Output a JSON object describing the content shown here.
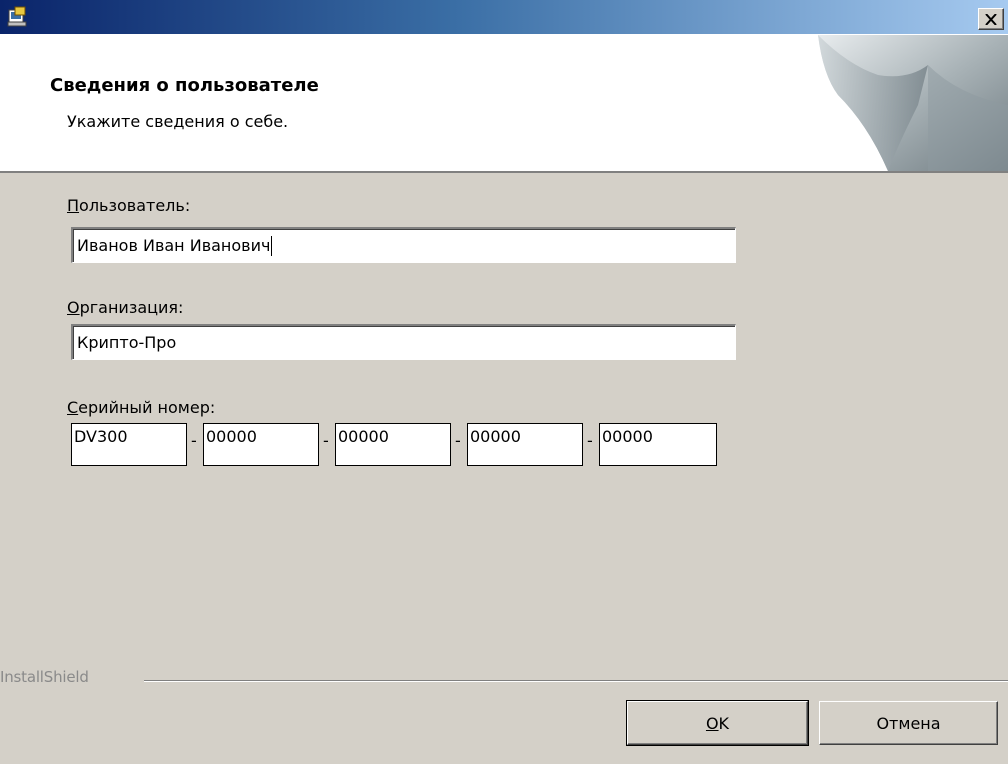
{
  "window": {
    "icon": "installer-icon",
    "close_icon": "close-x-icon"
  },
  "header": {
    "title": "Сведения о пользователе",
    "subtitle": "Укажите сведения о себе."
  },
  "form": {
    "user": {
      "label_accel": "П",
      "label_rest": "ользователь:",
      "value": "Иванов Иван Иванович"
    },
    "organization": {
      "label_accel": "О",
      "label_rest": "рганизация:",
      "value": "Крипто-Про"
    },
    "serial": {
      "label_accel": "С",
      "label_rest": "ерийный номер:",
      "separator": "-",
      "parts": [
        "DV300",
        "00000",
        "00000",
        "00000",
        "00000"
      ]
    }
  },
  "footer": {
    "brand": "InstallShield",
    "ok_accel": "O",
    "ok_rest": "K",
    "cancel_label": "Отмена"
  },
  "colors": {
    "titlebar_start": "#0a246a",
    "titlebar_end": "#a6caf0",
    "dialog_bg": "#d4d0c8"
  }
}
